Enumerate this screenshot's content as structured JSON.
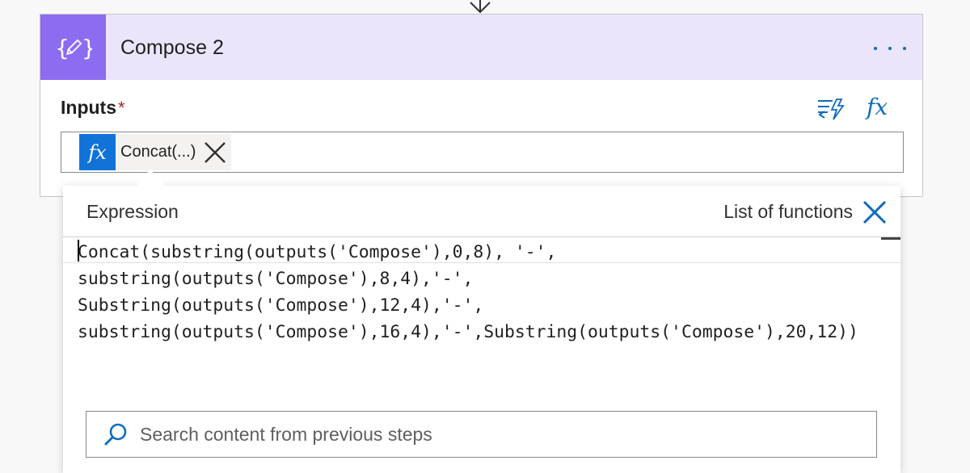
{
  "card": {
    "title": "Compose 2",
    "icon": "compose-curly-braces-icon"
  },
  "inputs": {
    "label": "Inputs",
    "required_marker": "*",
    "token": {
      "icon_text": "fx",
      "label": "Concat(...)"
    },
    "dynamic_content_icon": "dynamic-content-icon",
    "expression_icon_text": "fx"
  },
  "expression_panel": {
    "title": "Expression",
    "list_functions": "List of functions",
    "code_lines": [
      "Concat(substring(outputs('Compose'),0,8), '-',",
      "substring(outputs('Compose'),8,4),'-',",
      "Substring(outputs('Compose'),12,4),'-',",
      "substring(outputs('Compose'),16,4),'-',Substring(outputs('Compose'),20,12))"
    ],
    "search_placeholder": "Search content from previous steps"
  },
  "colors": {
    "header_bg": "#ebe5fb",
    "header_icon_bg": "#8c6cf0",
    "accent": "#0f6cbd",
    "token_fx_bg": "#1173d8",
    "required": "#a4262c"
  }
}
